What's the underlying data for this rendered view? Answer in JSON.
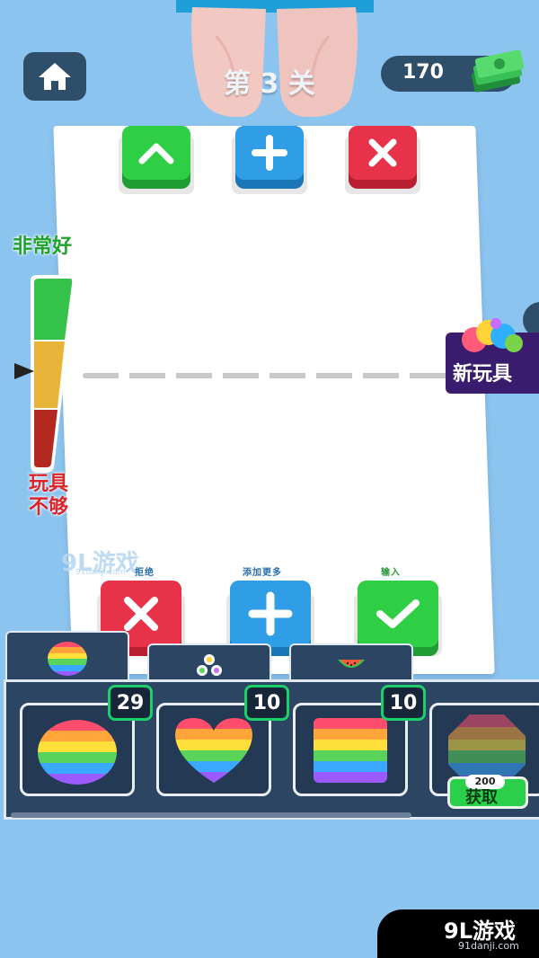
{
  "header": {
    "level_title": "第 3 关",
    "money": "170"
  },
  "meter": {
    "top_label": "非常好",
    "bottom_label_line1": "玩具",
    "bottom_label_line2": "不够",
    "level_fraction": 0.5
  },
  "board": {
    "top_keys": [
      "check-up",
      "plus",
      "cross"
    ],
    "bottom_keys": [
      {
        "label": "拒绝",
        "icon": "cross",
        "color": "#e8324a"
      },
      {
        "label": "添加更多",
        "icon": "plus",
        "color": "#2f9ee6"
      },
      {
        "label": "输入",
        "icon": "check",
        "color": "#2fcf45"
      }
    ]
  },
  "new_toy": {
    "label": "新玩具"
  },
  "watermark": {
    "text": "9L游戏",
    "sub": "91danji.com"
  },
  "tabs": [
    "pop-it",
    "fidget-spinner",
    "watermelon"
  ],
  "inventory": [
    {
      "shape": "circle",
      "count": "29"
    },
    {
      "shape": "heart",
      "count": "10"
    },
    {
      "shape": "square",
      "count": "10"
    },
    {
      "shape": "octagon",
      "price": "200",
      "action": "获取"
    }
  ],
  "corner_logo": {
    "main": "9L游戏",
    "sub": "91danji.com"
  },
  "colors": {
    "background": "#8cc4f0",
    "panel": "#2b4562",
    "accent_green": "#1bd06a"
  }
}
